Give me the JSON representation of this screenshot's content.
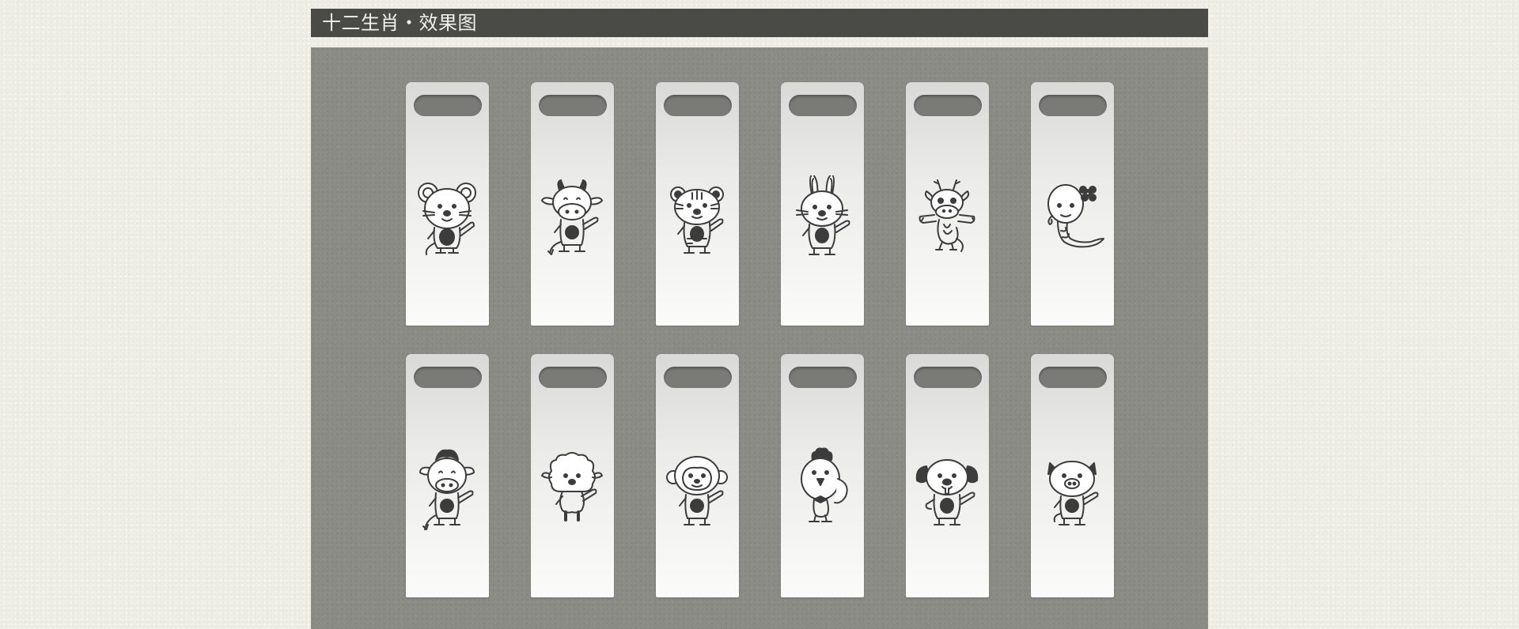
{
  "header": {
    "title": "十二生肖・效果图"
  },
  "colors": {
    "title_bar": "#4a4a46",
    "title_text": "#f1f1ec",
    "page_background": "#efeee6",
    "panel": "#8c8c86",
    "tag": "#f2f2f1",
    "line_art": "#3c3c3c"
  },
  "tags": [
    {
      "animal": "rat-icon"
    },
    {
      "animal": "ox-icon"
    },
    {
      "animal": "tiger-icon"
    },
    {
      "animal": "rabbit-icon"
    },
    {
      "animal": "dragon-icon"
    },
    {
      "animal": "snake-icon"
    },
    {
      "animal": "horse-icon"
    },
    {
      "animal": "goat-icon"
    },
    {
      "animal": "monkey-icon"
    },
    {
      "animal": "rooster-icon"
    },
    {
      "animal": "dog-icon"
    },
    {
      "animal": "pig-icon"
    }
  ]
}
